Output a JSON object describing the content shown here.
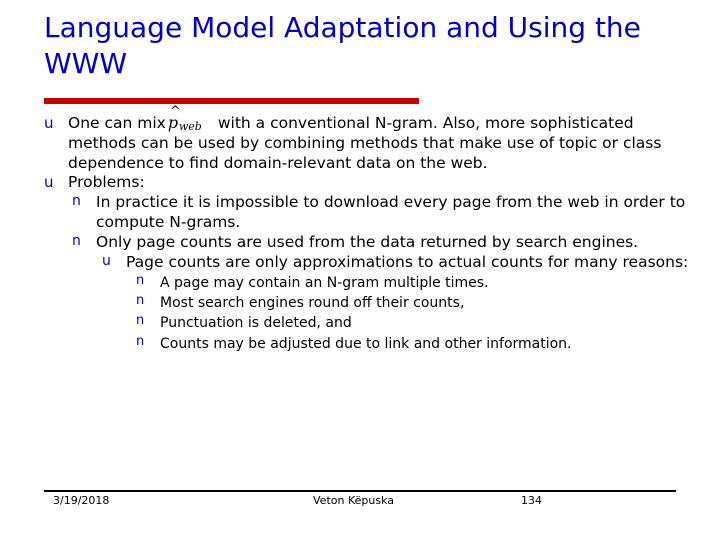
{
  "slide": {
    "title": "Language Model Adaptation and Using the WWW",
    "accent_title_color": "#0000cc",
    "accent_rule_color": "#cc0000",
    "bullets": {
      "level1_glyph": "u",
      "level2_glyph": "n",
      "level3_glyph": "u",
      "level4_glyph": "n"
    },
    "content": {
      "item1_part1": "One can mix",
      "formula": {
        "symbol": "p",
        "hat": "^",
        "subscript": "web"
      },
      "item1_part2": "with a conventional N-gram. Also, more sophisticated methods can be used by combining methods that make use of topic or class dependence to find domain-relevant data on the web.",
      "item2": "Problems:",
      "sub1": "In practice it is impossible to download every page from the web in order to compute N-grams.",
      "sub2": "Only page counts are used from the data returned by search engines.",
      "sub2a": "Page counts are only approximations to actual counts for many reasons:",
      "detail1": "A page may contain an N-gram multiple times.",
      "detail2": "Most search engines round off their counts,",
      "detail3": "Punctuation is deleted, and",
      "detail4": "Counts may be adjusted due to link and other information."
    },
    "footer": {
      "date": "3/19/2018",
      "author": "Veton Këpuska",
      "page": "134"
    }
  }
}
